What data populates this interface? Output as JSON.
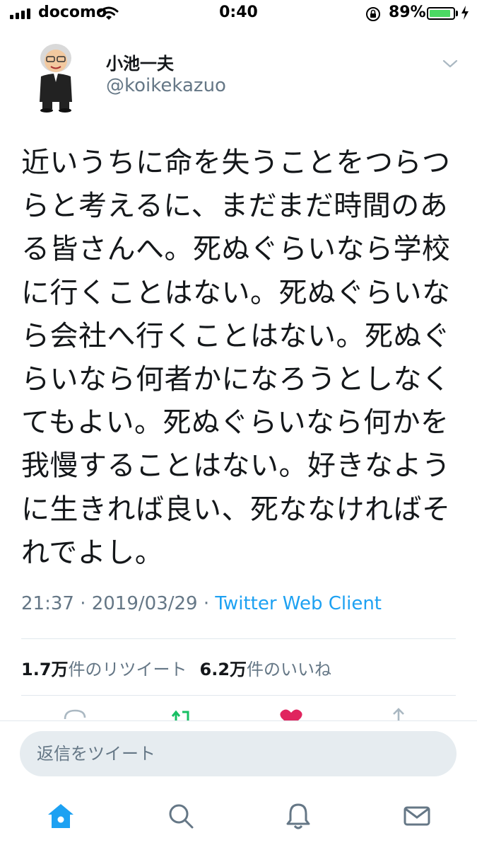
{
  "status_bar": {
    "carrier": "docomo",
    "time": "0:40",
    "battery_percent": "89%",
    "battery_level": 0.89
  },
  "tweet": {
    "display_name": "小池一夫",
    "handle": "@koikekazuo",
    "text": "近いうちに命を失うことをつらつらと考えるに、まだまだ時間のある皆さんへ。死ぬぐらいなら学校に行くことはない。死ぬぐらいなら会社へ行くことはない。死ぬぐらいなら何者かになろうとしなくてもよい。死ぬぐらいなら何かを我慢することはない。好きなように生きれば良い、死ななければそれでよし。",
    "timestamp": "21:37 · 2019/03/29 · ",
    "source": "Twitter Web Client"
  },
  "stats": {
    "retweet_count": "1.7万",
    "retweet_label": "件のリツイート",
    "like_count": "6.2万",
    "like_label": "件のいいね"
  },
  "reply": {
    "placeholder": "返信をツイート"
  },
  "colors": {
    "accent": "#1da1f2",
    "secondary_text": "#657786",
    "like": "#e0245e",
    "retweet": "#17bf63",
    "battery": "#4cd964"
  },
  "icons": {
    "tabs": [
      "home-icon",
      "search-icon",
      "notifications-icon",
      "messages-icon"
    ],
    "actions": [
      "reply-icon",
      "retweet-icon",
      "like-icon",
      "share-icon"
    ]
  }
}
